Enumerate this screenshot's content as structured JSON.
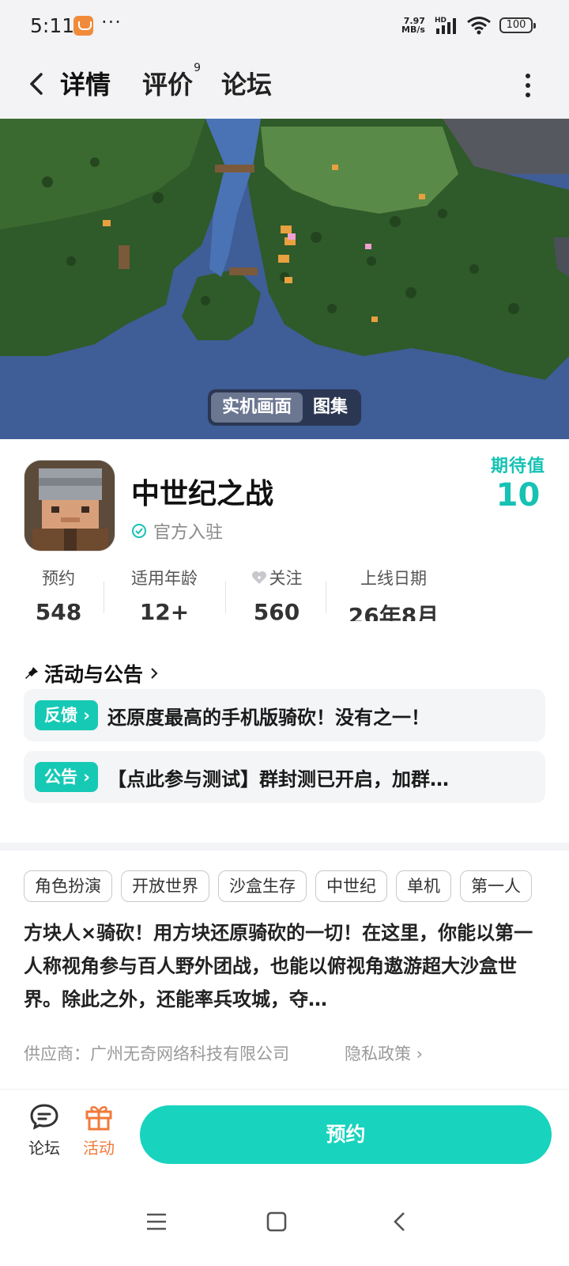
{
  "status_bar": {
    "time": "5:11",
    "net_speed_value": "7.97",
    "net_speed_unit": "MB/s",
    "hd": "HD",
    "battery": "100"
  },
  "nav": {
    "tabs": [
      {
        "label": "详情",
        "active": true
      },
      {
        "label": "评价",
        "superscript": "9"
      },
      {
        "label": "论坛"
      }
    ]
  },
  "hero": {
    "toggle": {
      "active": "实机画面",
      "inactive": "图集"
    }
  },
  "app": {
    "title": "中世纪之战",
    "verified_label": "官方入驻",
    "expect_label": "期待值",
    "expect_value": "10"
  },
  "stats": [
    {
      "label": "预约",
      "value": "548"
    },
    {
      "label": "适用年龄",
      "value": "12+"
    },
    {
      "label": "关注",
      "value": "560",
      "icon": "heart-icon"
    },
    {
      "label": "上线日期",
      "value": "26年8月"
    }
  ],
  "announcements": {
    "header": "活动与公告",
    "items": [
      {
        "tag": "反馈",
        "text": "还原度最高的手机版骑砍！没有之一！"
      },
      {
        "tag": "公告",
        "text": "【点此参与测试】群封测已开启，加群…"
      }
    ]
  },
  "tags": [
    "角色扮演",
    "开放世界",
    "沙盒生存",
    "中世纪",
    "单机",
    "第一人"
  ],
  "description": "方块人×骑砍！用方块还原骑砍的一切！在这里，你能以第一人称视角参与百人野外团战，也能以俯视角遨游超大沙盒世界。除此之外，还能率兵攻城，夺…",
  "provider": "供应商：广州无奇网络科技有限公司",
  "privacy": "隐私政策",
  "bottom_bar": {
    "forum": "论坛",
    "activity": "活动",
    "reserve": "预约"
  },
  "colors": {
    "accent": "#18d3be",
    "activity": "#f07a3a"
  }
}
